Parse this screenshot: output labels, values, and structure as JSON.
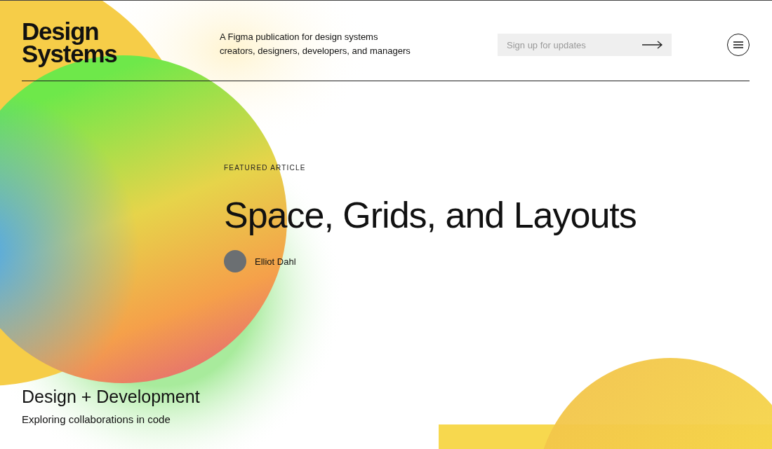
{
  "logo": {
    "line_1": "Design",
    "line_2": "Systems"
  },
  "tagline": {
    "line_1": "A Figma publication for design systems",
    "line_2": "creators, designers, developers, and managers"
  },
  "signup": {
    "placeholder": "Sign up for updates"
  },
  "featured": {
    "eyebrow": "FEATURED ARTICLE",
    "title": "Space, Grids, and Layouts",
    "author": "Elliot Dahl"
  },
  "section": {
    "title": "Design + Development",
    "subtitle": "Exploring collaborations in code"
  }
}
